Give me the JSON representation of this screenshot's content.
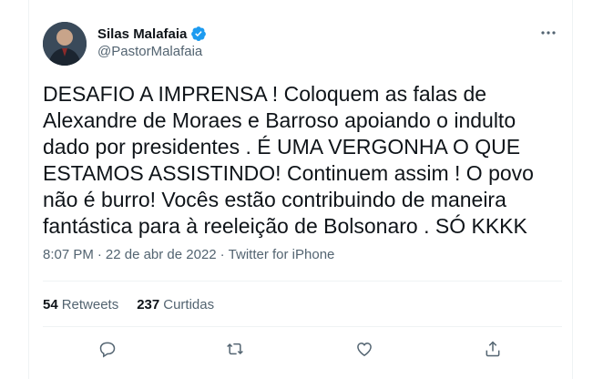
{
  "author": {
    "display_name": "Silas Malafaia",
    "handle": "@PastorMalafaia",
    "verified": true
  },
  "tweet": {
    "text": "DESAFIO A IMPRENSA ! Coloquem as falas de\nAlexandre de Moraes e Barroso apoiando o indulto\ndado por presidentes . É UMA VERGONHA O QUE\nESTAMOS ASSISTINDO! Continuem assim ! O povo\nnão é burro! Vocês estão contribuindo de maneira\nfantástica para à reeleição de Bolsonaro . SÓ KKKK",
    "time": "8:07 PM",
    "separator": "·",
    "date": "22 de abr de 2022",
    "source": "Twitter for iPhone"
  },
  "stats": {
    "retweets_count": "54",
    "retweets_label": "Retweets",
    "likes_count": "237",
    "likes_label": "Curtidas"
  },
  "icons": {
    "more": "more-icon",
    "reply": "reply-icon",
    "retweet": "retweet-icon",
    "like": "like-icon",
    "share": "share-icon",
    "verified": "verified-badge-icon"
  },
  "colors": {
    "accent": "#1d9bf0",
    "text_primary": "#0f1419",
    "text_secondary": "#536471",
    "border": "#eff3f4"
  }
}
